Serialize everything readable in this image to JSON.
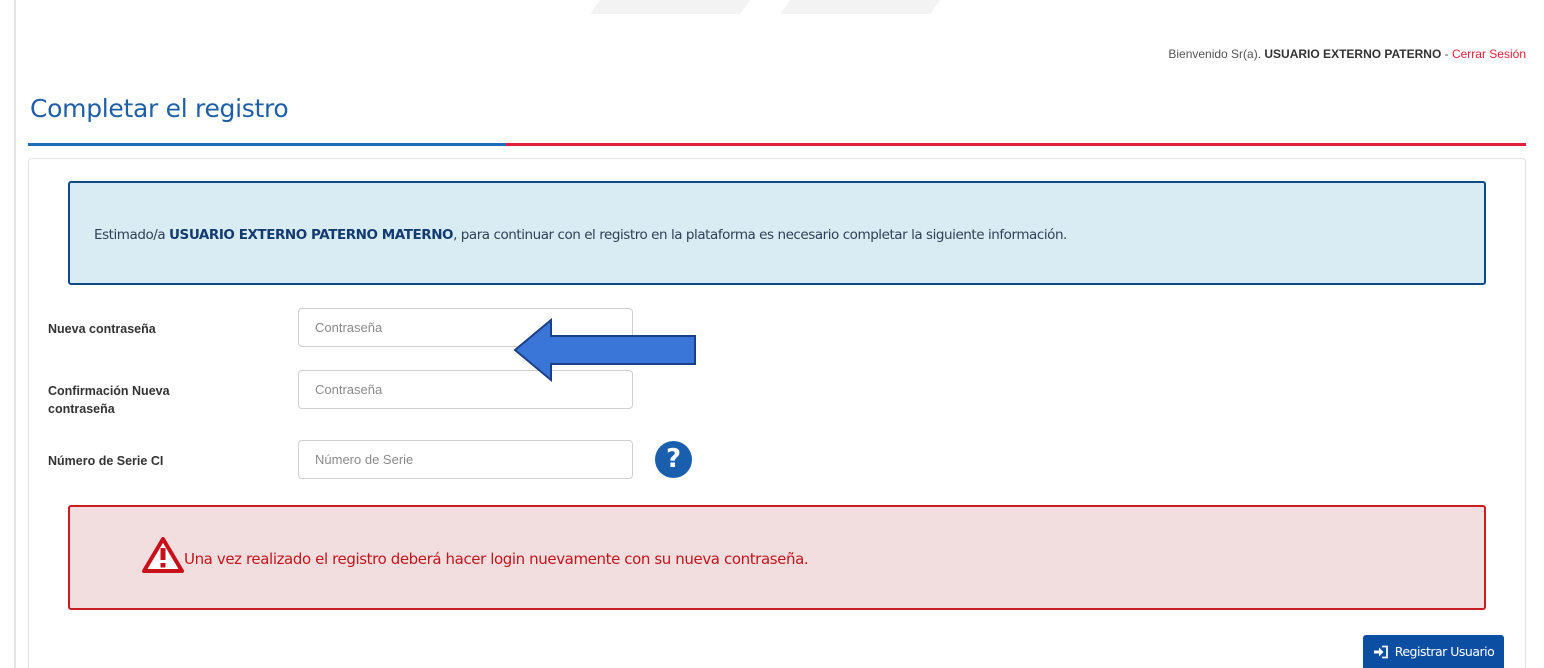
{
  "header": {
    "welcome_prefix": "Bienvenido Sr(a). ",
    "user_name": "USUARIO EXTERNO PATERNO",
    "separator": " - ",
    "logout_label": "Cerrar Sesión"
  },
  "page": {
    "title": "Completar el registro"
  },
  "info": {
    "prefix": "Estimado/a ",
    "user_full_name": "USUARIO EXTERNO PATERNO MATERNO",
    "suffix": ", para continuar con el registro en la plataforma es necesario completar la siguiente información."
  },
  "form": {
    "new_password": {
      "label": "Nueva contraseña",
      "placeholder": "Contraseña",
      "value": ""
    },
    "confirm_password": {
      "label_line1": "Confirmación Nueva",
      "label_line2": "contraseña",
      "placeholder": "Contraseña",
      "value": ""
    },
    "serial_number": {
      "label": "Número de Serie CI",
      "placeholder": "Número de Serie",
      "value": ""
    },
    "help_icon_glyph": "?"
  },
  "warning": {
    "text": "Una vez realizado el registro deberá hacer login nuevamente con su nueva contraseña.",
    "icon": "warning-triangle-icon"
  },
  "actions": {
    "register_label": "Registrar Usuario",
    "register_icon": "sign-in-icon"
  },
  "colors": {
    "brand_blue": "#1f5fa6",
    "accent_red": "#e0203a",
    "info_bg": "#d9ecf4",
    "warning_bg": "#f2dede",
    "button_bg": "#0b4ea2",
    "overlay_arrow": "#3a75d8"
  }
}
